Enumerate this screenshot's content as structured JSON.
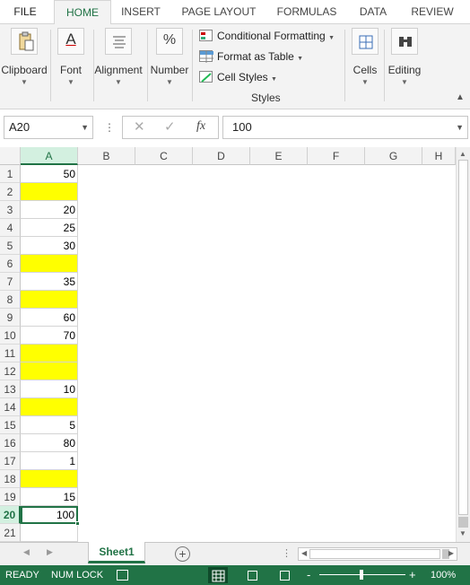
{
  "ribbon": {
    "tabs": [
      "FILE",
      "HOME",
      "INSERT",
      "PAGE LAYOUT",
      "FORMULAS",
      "DATA",
      "REVIEW"
    ],
    "active_tab": "HOME",
    "groups": {
      "clipboard": "Clipboard",
      "font": "Font",
      "alignment": "Alignment",
      "number": "Number",
      "cells": "Cells",
      "editing": "Editing"
    },
    "font_icon_glyph": "A",
    "number_icon_glyph": "%",
    "styles": {
      "conditional_formatting": "Conditional Formatting",
      "format_as_table": "Format as Table",
      "cell_styles": "Cell Styles",
      "label": "Styles"
    }
  },
  "formula_bar": {
    "name_box": "A20",
    "fx_label": "fx",
    "formula": "100"
  },
  "sheet": {
    "columns": [
      "A",
      "B",
      "C",
      "D",
      "E",
      "F",
      "G",
      "H"
    ],
    "selected_column": "A",
    "selected_row": 20,
    "highlight_color": "#ffff00",
    "rows": [
      {
        "row": "1",
        "value": "50",
        "yellow": false
      },
      {
        "row": "2",
        "value": "",
        "yellow": true
      },
      {
        "row": "3",
        "value": "20",
        "yellow": false
      },
      {
        "row": "4",
        "value": "25",
        "yellow": false
      },
      {
        "row": "5",
        "value": "30",
        "yellow": false
      },
      {
        "row": "6",
        "value": "",
        "yellow": true
      },
      {
        "row": "7",
        "value": "35",
        "yellow": false
      },
      {
        "row": "8",
        "value": "",
        "yellow": true
      },
      {
        "row": "9",
        "value": "60",
        "yellow": false
      },
      {
        "row": "10",
        "value": "70",
        "yellow": false
      },
      {
        "row": "11",
        "value": "",
        "yellow": true
      },
      {
        "row": "12",
        "value": "",
        "yellow": true
      },
      {
        "row": "13",
        "value": "10",
        "yellow": false
      },
      {
        "row": "14",
        "value": "",
        "yellow": true
      },
      {
        "row": "15",
        "value": "5",
        "yellow": false
      },
      {
        "row": "16",
        "value": "80",
        "yellow": false
      },
      {
        "row": "17",
        "value": "1",
        "yellow": false
      },
      {
        "row": "18",
        "value": "",
        "yellow": true
      },
      {
        "row": "19",
        "value": "15",
        "yellow": false
      },
      {
        "row": "20",
        "value": "100",
        "yellow": false
      },
      {
        "row": "21",
        "value": "",
        "yellow": false
      }
    ]
  },
  "sheet_tabs": {
    "active": "Sheet1"
  },
  "status_bar": {
    "ready": "READY",
    "num_lock": "NUM LOCK",
    "zoom": "100%",
    "zoom_minus": "-",
    "zoom_plus": "+"
  },
  "colors": {
    "accent": "#217346",
    "yellow_fill": "#ffff00"
  }
}
